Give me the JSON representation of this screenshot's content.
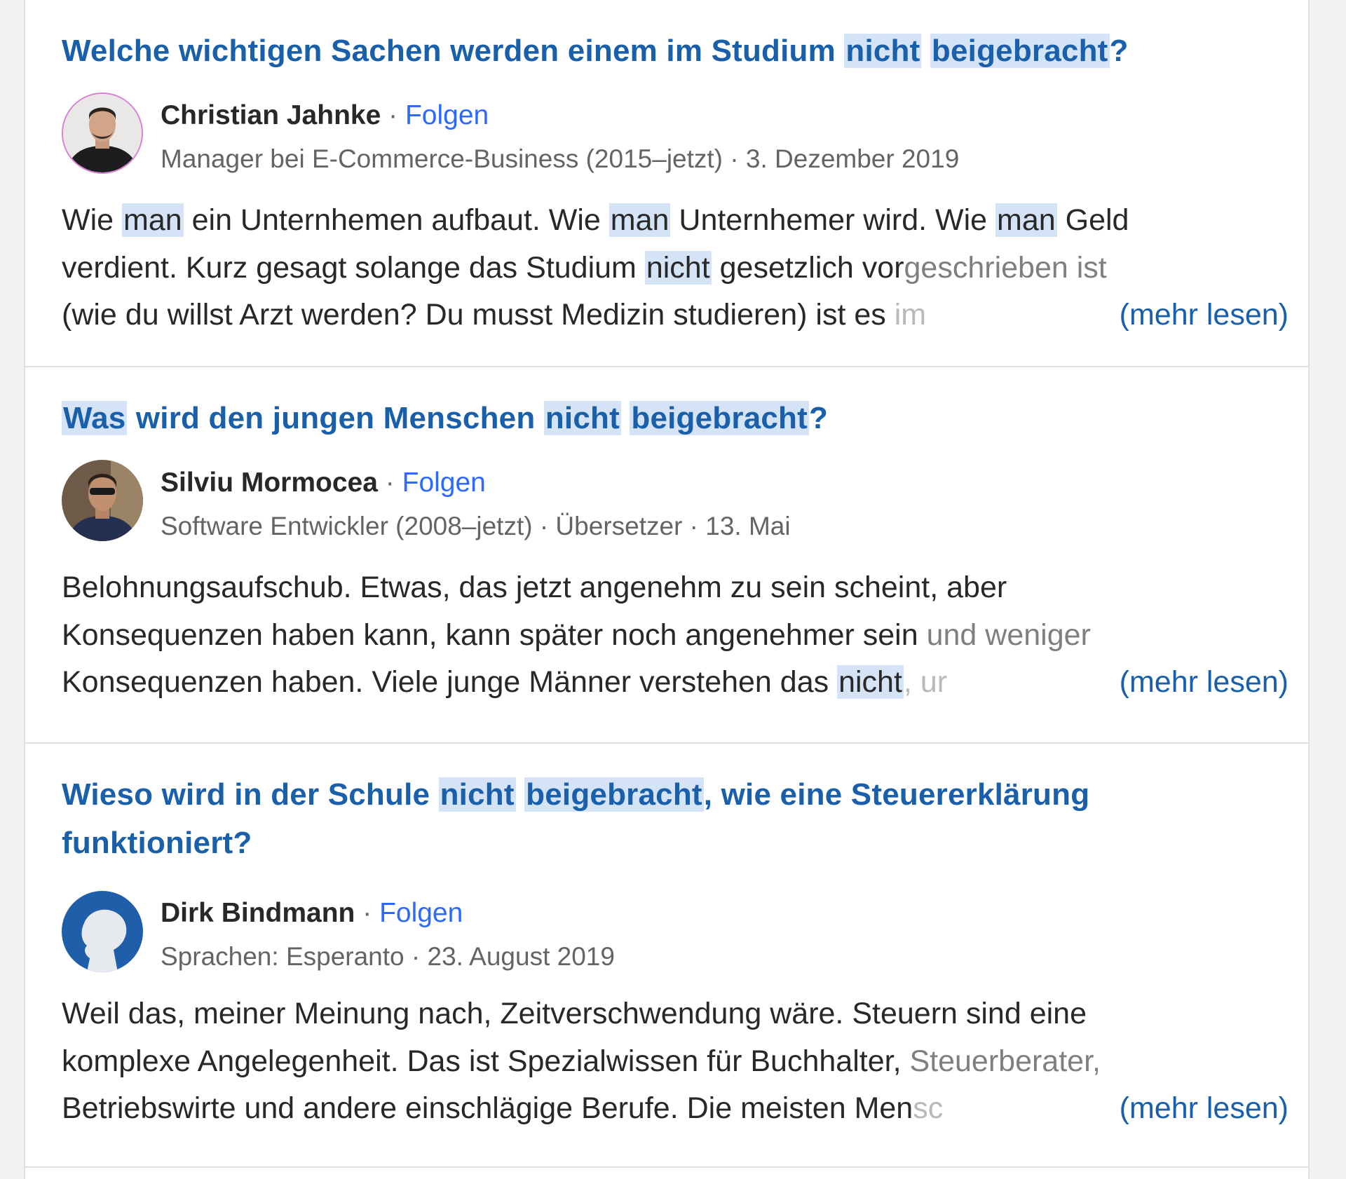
{
  "colors": {
    "title": "#195faa",
    "follow": "#2e69ff",
    "highlight": "#d5e3f7",
    "text": "#282829",
    "meta": "#636466"
  },
  "answers": [
    {
      "title_parts": [
        "Welche wichtigen Sachen werden einem im Studium ",
        "nicht",
        " ",
        "beigebracht",
        "?"
      ],
      "author": "Christian Jahnke",
      "dot": "·",
      "follow": "Folgen",
      "credential": "Manager bei E-Commerce-Business (2015–jetzt) · 3. Dezember 2019",
      "avatar": "person-avatar",
      "lines": [
        [
          "Wie ",
          "man",
          " ein Unternhemen aufbaut. Wie ",
          "man",
          " Unternhemer wird. Wie ",
          "man",
          " Geld"
        ],
        [
          "verdient. Kurz gesagt solange das Studium ",
          "nicht",
          " gesetzlich vor",
          "geschrieben ist"
        ],
        [
          "(wie du willst Arzt werden? Du musst Medizin studieren) ist es ",
          "im"
        ]
      ],
      "more": "(mehr lesen)"
    },
    {
      "title_parts": [
        "Was",
        " wird den jungen Menschen ",
        "nicht",
        " ",
        "beigebracht",
        "?"
      ],
      "author": "Silviu Mormocea",
      "dot": "·",
      "follow": "Folgen",
      "credential": "Software Entwickler (2008–jetzt) · Übersetzer · 13. Mai",
      "avatar": "person-avatar",
      "lines": [
        [
          "Belohnungsaufschub. Etwas, das jetzt angenehm zu sein scheint, aber"
        ],
        [
          "Konsequenzen haben kann, kann später noch angenehmer sein ",
          "und weniger"
        ],
        [
          "Konsequenzen haben. Viele junge Männer verstehen das ",
          "nicht",
          ", ur"
        ]
      ],
      "more": "(mehr lesen)"
    },
    {
      "title_parts": [
        "Wieso wird in der Schule ",
        "nicht",
        " ",
        "beigebracht",
        ", wie eine Steuererklärung"
      ],
      "title_line2": "funktioniert?",
      "author": "Dirk Bindmann",
      "dot": "·",
      "follow": "Folgen",
      "credential": "Sprachen: Esperanto · 23. August 2019",
      "avatar": "default-user-icon",
      "lines": [
        [
          "Weil das, meiner Meinung nach, Zeitverschwendung wäre. Steuern sind eine"
        ],
        [
          "komplexe Angelegenheit. Das ist Spezialwissen für Buchhalter, ",
          "Steuerberater,"
        ],
        [
          "Betriebswirte und andere einschlägige Berufe. Die meisten Men",
          "sc"
        ]
      ],
      "more": "(mehr lesen)"
    }
  ]
}
